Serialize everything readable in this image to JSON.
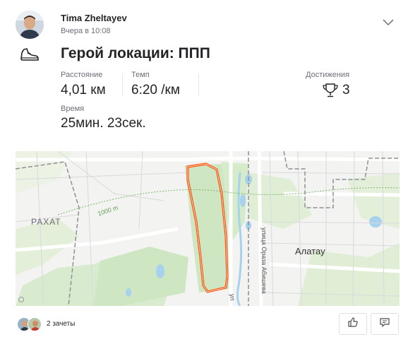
{
  "athlete": {
    "name": "Tima Zheltayev",
    "timestamp": "Вчера в 10:08"
  },
  "activity": {
    "title": "Герой локации: ППП",
    "sport_icon": "running-shoe-icon",
    "stats": [
      {
        "label": "Расстояние",
        "value": "4,01 км"
      },
      {
        "label": "Темп",
        "value": "6:20 /км"
      },
      {
        "label": "Время",
        "value": "25мин. 23сек."
      }
    ],
    "achievements": {
      "label": "Достижения",
      "count": "3",
      "icon": "trophy-icon"
    }
  },
  "map": {
    "labels": {
      "district_left": "РАХАТ",
      "district_right": "Алатау",
      "street": "улица Ораза Абишева",
      "street_partial": "ул",
      "contour": "1000 m"
    },
    "route_color": "#fc4c02"
  },
  "social": {
    "kudos_text": "2 зачеты"
  },
  "actions": {
    "kudos_icon": "thumbs-up-icon",
    "comment_icon": "comment-icon"
  }
}
